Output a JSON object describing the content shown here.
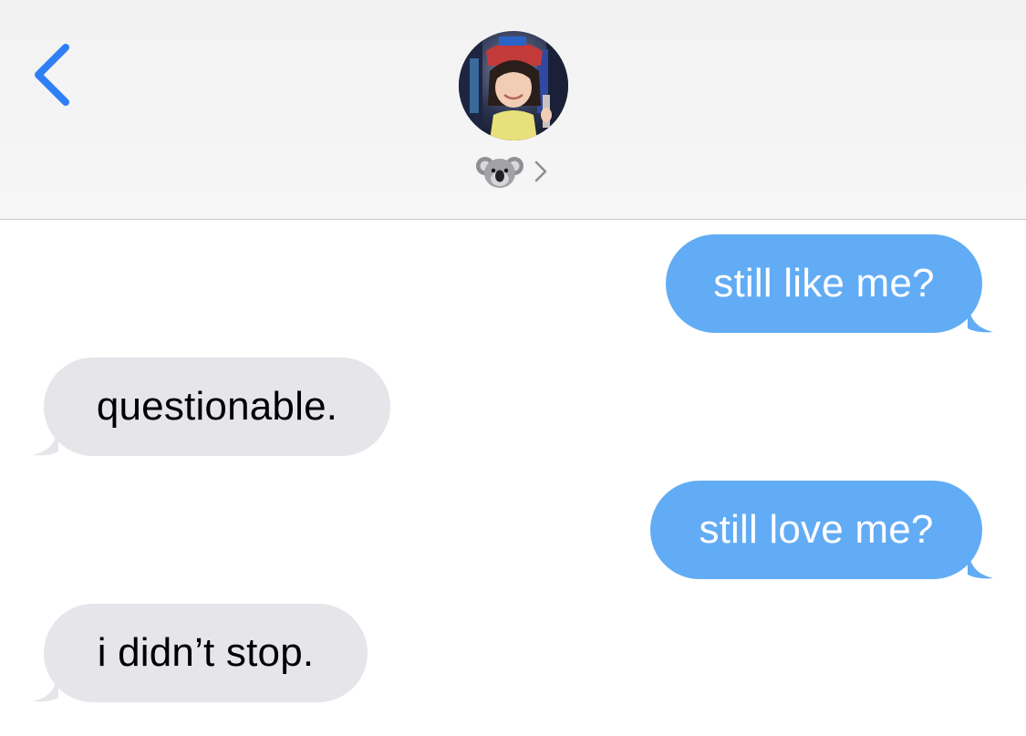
{
  "header": {
    "contact_emoji": "🐨",
    "back_icon": "chevron-left-icon",
    "details_icon": "chevron-right-icon",
    "accent_color": "#2f7ff6"
  },
  "messages": [
    {
      "direction": "sent",
      "text": "still like me?"
    },
    {
      "direction": "received",
      "text": "questionable."
    },
    {
      "direction": "sent",
      "text": "still love me?"
    },
    {
      "direction": "received",
      "text": "i didn’t stop."
    }
  ],
  "colors": {
    "sent_bubble": "#62acf5",
    "received_bubble": "#e5e5ea",
    "header_bg": "#f4f4f4"
  }
}
